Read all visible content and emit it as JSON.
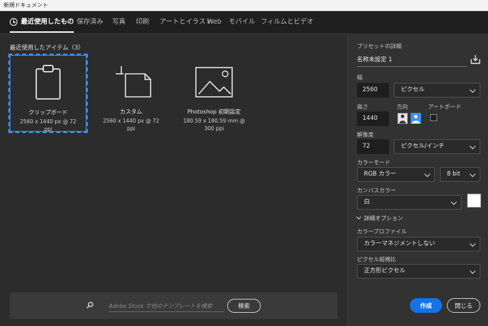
{
  "window": {
    "title": "新規ドキュメント"
  },
  "tabs": [
    {
      "label": "最近使用したもの",
      "active": true
    },
    {
      "label": "保存済み"
    },
    {
      "label": "写真"
    },
    {
      "label": "印刷"
    },
    {
      "label": "アートとイラスト"
    },
    {
      "label": "Web"
    },
    {
      "label": "モバイル"
    },
    {
      "label": "フィルムとビデオ"
    }
  ],
  "recent": {
    "heading": "最近使用したアイテム（3）",
    "items": [
      {
        "name": "クリップボード",
        "dims": "2560 x 1440 px @ 72 ppi",
        "icon": "clipboard-icon",
        "selected": true
      },
      {
        "name": "カスタム",
        "dims": "2560 x 1440 px @ 72 ppi",
        "icon": "custom-document-icon"
      },
      {
        "name": "Photoshop 初期設定",
        "dims": "180.59 x 180.59 mm @ 300 ppi",
        "icon": "image-document-icon"
      }
    ]
  },
  "search": {
    "placeholder": "Adobe Stock で他のテンプレートを検索",
    "button": "検索"
  },
  "preset": {
    "heading": "プリセットの詳細",
    "name": "名称未設定 1",
    "width_label": "幅",
    "width": "2560",
    "unit": "ピクセル",
    "height_label": "高さ",
    "height": "1440",
    "orientation_label": "方向",
    "artboard_label": "アートボード",
    "resolution_label": "解像度",
    "resolution": "72",
    "resolution_unit": "ピクセル/インチ",
    "color_mode_label": "カラーモード",
    "color_mode": "RGB カラー",
    "bit_depth": "8 bit",
    "canvas_color_label": "カンバスカラー",
    "canvas_color": "白",
    "canvas_swatch": "#ffffff",
    "advanced_label": "詳細オプション",
    "color_profile_label": "カラープロファイル",
    "color_profile": "カラーマネジメントしない",
    "pixel_aspect_label": "ピクセル縦横比",
    "pixel_aspect": "正方形ピクセル"
  },
  "actions": {
    "create": "作成",
    "close": "閉じる"
  },
  "colors": {
    "accent": "#1473e6",
    "selection": "#3c8ff0"
  }
}
